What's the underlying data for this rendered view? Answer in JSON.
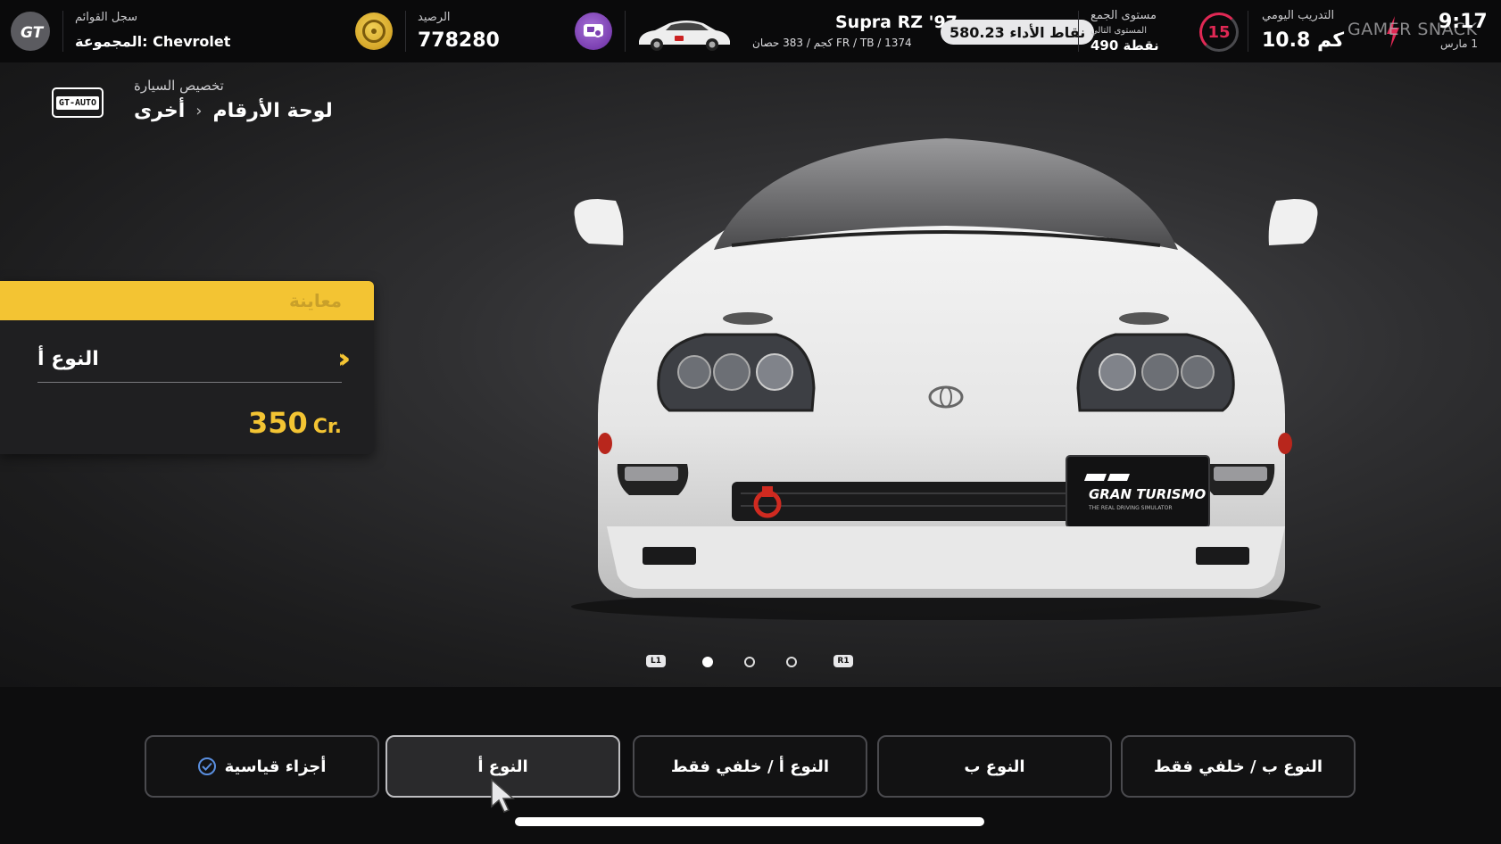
{
  "topbar": {
    "records_label": "سجل القوائم",
    "group_label": "المجموعة: Chevrolet",
    "balance_label": "الرصيد",
    "balance_value": "778280",
    "car_name": "Supra RZ '97",
    "car_specs": "FR / TB / 1374 كجم / 383 حصان",
    "pp_badge": "نقاط الأداء 580.23",
    "collector_label": "مستوى الجمع",
    "next_level_label": "المستوى التالي",
    "next_level_points": "490 نقطة",
    "collector_level": "15",
    "daily_label": "التدريب اليومي",
    "daily_value": "10.8 كم",
    "watermark": "GAMER SNACK",
    "clock": "9:17",
    "date": "1 مارس"
  },
  "breadcrumb": {
    "section": "تخصيص السيارة",
    "item_current": "لوحة الأرقام",
    "item_parent": "أخرى",
    "logo_text": "GT-AUTO"
  },
  "preview": {
    "header": "معاينة",
    "part_name": "النوع أ",
    "price": "350",
    "currency": "Cr."
  },
  "pager": {
    "left_button": "L1",
    "right_button": "R1",
    "pages": 3,
    "active_page": 1
  },
  "options": [
    {
      "label": "أجزاء قياسية",
      "installed": true
    },
    {
      "label": "النوع أ",
      "selected": true
    },
    {
      "label": "النوع أ / خلفي فقط"
    },
    {
      "label": "النوع ب"
    },
    {
      "label": "النوع ب / خلفي فقط"
    }
  ],
  "plate": {
    "brand": "GRAN TURISMO",
    "tagline": "THE REAL DRIVING SIMULATOR"
  },
  "colors": {
    "accent_yellow": "#f3c433",
    "level_red": "#e02854",
    "check_blue": "#5a8fe0"
  }
}
